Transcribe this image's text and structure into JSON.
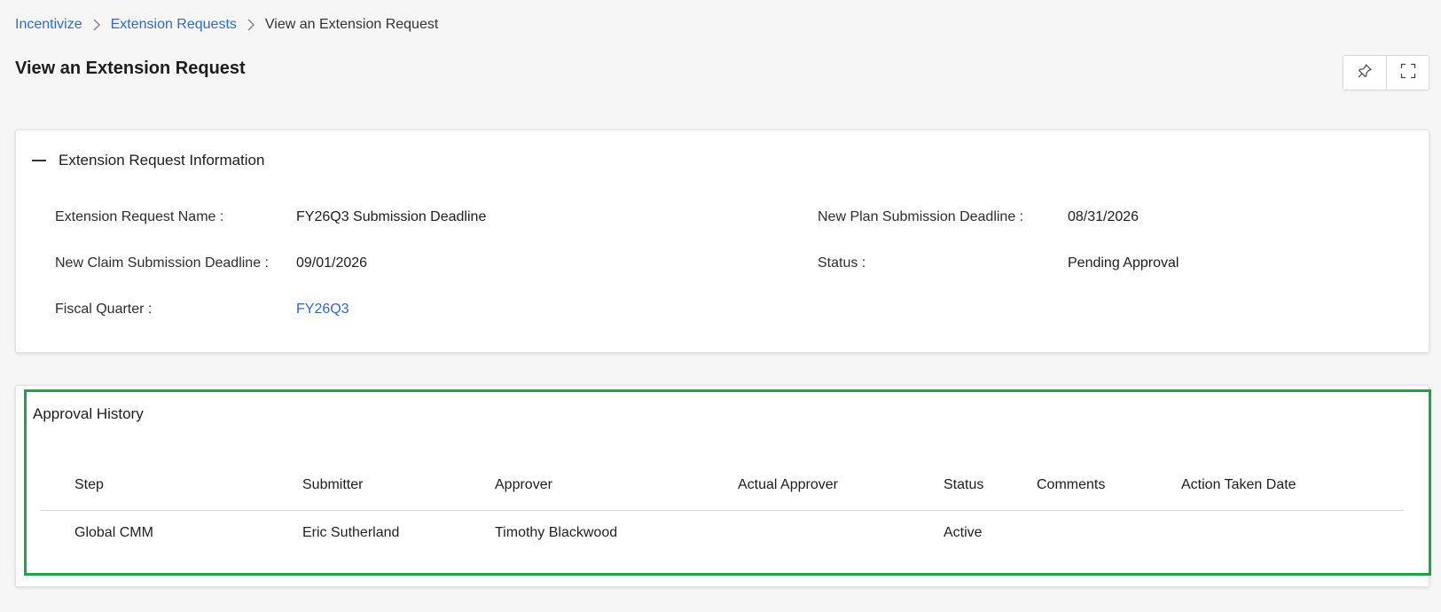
{
  "breadcrumb": {
    "items": [
      "Incentivize",
      "Extension Requests"
    ],
    "current": "View an Extension Request"
  },
  "page_title": "View an Extension Request",
  "title_actions": {
    "pin_icon": "pin-icon",
    "fullscreen_icon": "expand-icon"
  },
  "info_section": {
    "title": "Extension Request Information",
    "fields": {
      "name_label": "Extension Request Name :",
      "name_value": "FY26Q3 Submission Deadline",
      "plan_deadline_label": "New Plan Submission Deadline :",
      "plan_deadline_value": "08/31/2026",
      "claim_deadline_label": "New Claim Submission Deadline :",
      "claim_deadline_value": "09/01/2026",
      "status_label": "Status :",
      "status_value": "Pending Approval",
      "fiscal_quarter_label": "Fiscal Quarter :",
      "fiscal_quarter_value": "FY26Q3"
    }
  },
  "approval_history": {
    "title": "Approval History",
    "columns": [
      "Step",
      "Submitter",
      "Approver",
      "Actual Approver",
      "Status",
      "Comments",
      "Action Taken Date"
    ],
    "rows": [
      [
        "Global CMM",
        "Eric Sutherland",
        "Timothy Blackwood",
        "",
        "Active",
        "",
        ""
      ]
    ]
  },
  "colors": {
    "link": "#2f6ac8",
    "highlight": "#1ea34a"
  }
}
